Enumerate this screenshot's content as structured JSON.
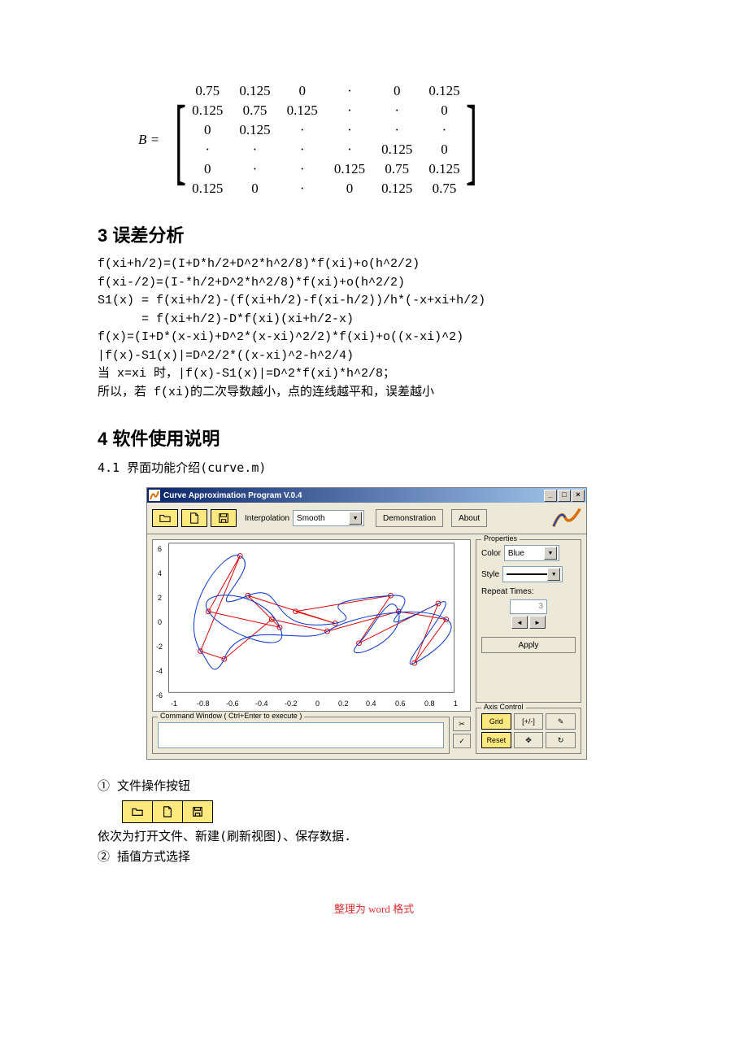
{
  "matrix": {
    "lhs": "B =",
    "rows": [
      [
        "0.75",
        "0.125",
        "0",
        "·",
        "0",
        "0.125"
      ],
      [
        "0.125",
        "0.75",
        "0.125",
        "·",
        "·",
        "0"
      ],
      [
        "0",
        "0.125",
        "·",
        "·",
        "·",
        "·"
      ],
      [
        "·",
        "·",
        "·",
        "·",
        "0.125",
        "0"
      ],
      [
        "0",
        "·",
        "·",
        "0.125",
        "0.75",
        "0.125"
      ],
      [
        "0.125",
        "0",
        "·",
        "0",
        "0.125",
        "0.75"
      ]
    ]
  },
  "sec3": {
    "title": "3  误差分析",
    "lines": [
      "f(xi+h/2)=(I+D*h/2+D^2*h^2/8)*f(xi)+o(h^2/2)",
      "f(xi-/2)=(I-*h/2+D^2*h^2/8)*f(xi)+o(h^2/2)",
      "S1(x) = f(xi+h/2)-(f(xi+h/2)-f(xi-h/2))/h*(-x+xi+h/2)",
      "      = f(xi+h/2)-D*f(xi)(xi+h/2-x)",
      "f(x)=(I+D*(x-xi)+D^2*(x-xi)^2/2)*f(xi)+o((x-xi)^2)",
      "|f(x)-S1(x)|=D^2/2*((x-xi)^2-h^2/4)",
      "当 x=xi 时，|f(x)-S1(x)|=D^2*f(xi)*h^2/8；",
      "所以，若 f(xi)的二次导数越小，点的连线越平和，误差越小"
    ]
  },
  "sec4": {
    "title": "4  软件使用说明",
    "sub": "4.1 界面功能介绍(curve.m)"
  },
  "app": {
    "title": "Curve Approximation Program V.0.4",
    "toolbar": {
      "interp_label": "Interpolation",
      "interp_value": "Smooth",
      "demo": "Demonstration",
      "about": "About"
    },
    "plot": {
      "yticks": [
        "6",
        "4",
        "2",
        "0",
        "-2",
        "-4",
        "-6"
      ],
      "xticks": [
        "-1",
        "-0.8",
        "-0.6",
        "-0.4",
        "-0.2",
        "0",
        "0.2",
        "0.4",
        "0.6",
        "0.8",
        "1"
      ]
    },
    "cmd_legend": "Command Window ( Ctrl+Enter to execute )",
    "props": {
      "legend": "Properties",
      "color_label": "Color",
      "color_value": "Blue",
      "style_label": "Style",
      "repeat_label": "Repeat Times:",
      "repeat_value": "3",
      "apply": "Apply"
    },
    "axis": {
      "legend": "Axis Control",
      "grid": "Grid",
      "zoom": "[+/-]",
      "reset": "Reset"
    }
  },
  "desc": {
    "l1": "① 文件操作按钮",
    "l2": "    依次为打开文件、新建(刷新视图)、保存数据.",
    "l3": "② 插值方式选择"
  },
  "footer": "整理为 word 格式"
}
